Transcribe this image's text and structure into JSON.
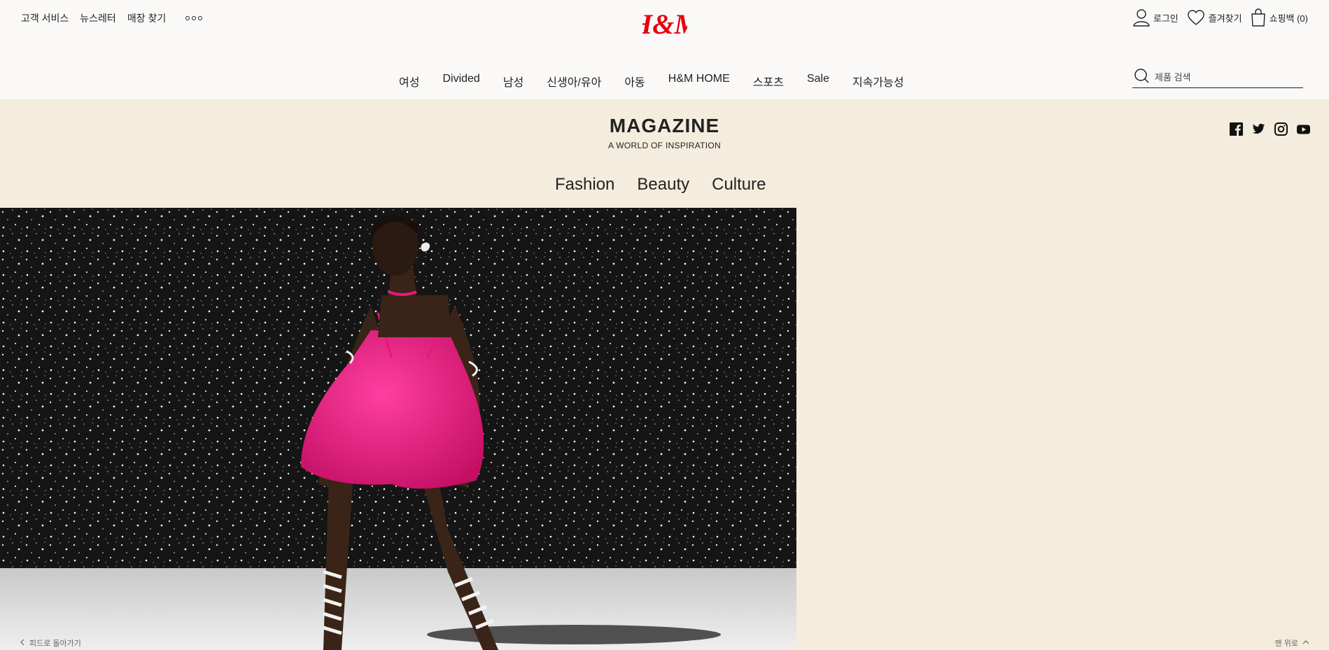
{
  "header": {
    "utility_links": [
      "고객 서비스",
      "뉴스레터",
      "매장 찾기"
    ],
    "more_icon": "more-dots-icon",
    "logo_text": "H&M",
    "login_label": "로그인",
    "favorites_label": "즐겨찾기",
    "cart_label": "쇼핑백 (0)",
    "nav": [
      "여성",
      "Divided",
      "남성",
      "신생아/유아",
      "아동",
      "H&M HOME",
      "스포츠",
      "Sale",
      "지속가능성"
    ],
    "search": {
      "placeholder": "제품 검색",
      "value": ""
    }
  },
  "magazine": {
    "title": "MAGAZINE",
    "subtitle": "A WORLD OF INSPIRATION",
    "social_icons": [
      "facebook-icon",
      "twitter-icon",
      "instagram-icon",
      "youtube-icon"
    ],
    "categories": [
      "Fashion",
      "Beauty",
      "Culture"
    ]
  },
  "footer": {
    "back_label": "피드로 돌아가기",
    "top_label": "맨 위로"
  },
  "colors": {
    "header_bg": "#faf9f8",
    "page_bg": "#f4ecdd",
    "brand_red": "#e50010",
    "dress_pink": "#e8187a"
  }
}
